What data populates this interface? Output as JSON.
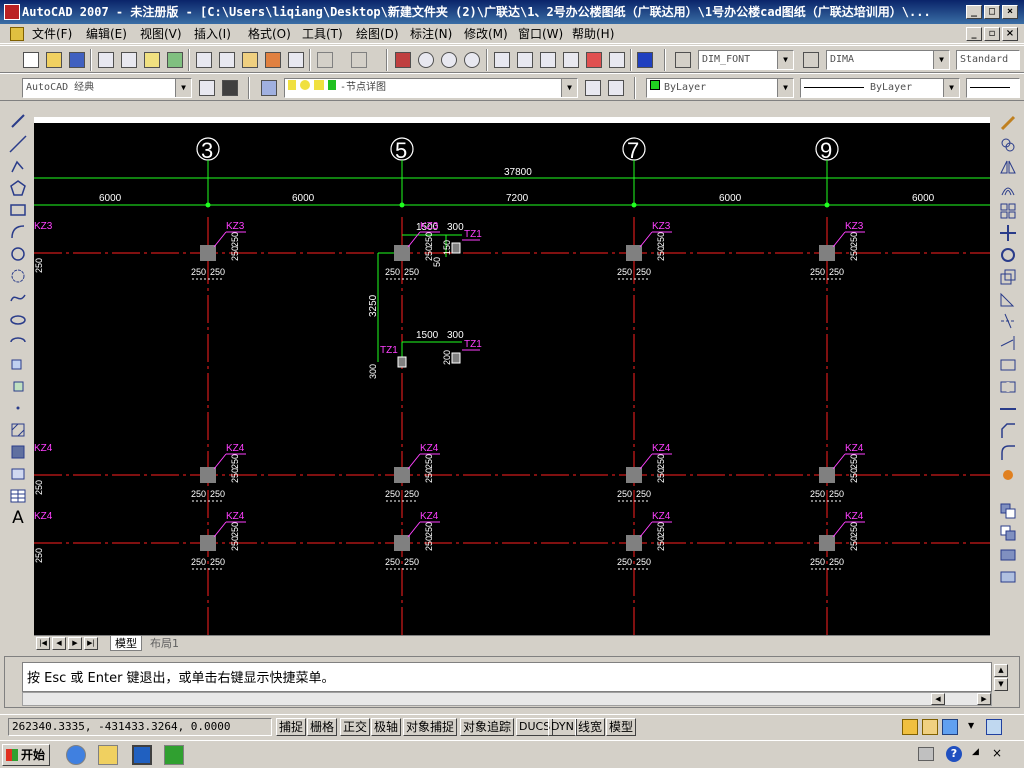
{
  "window": {
    "title": "AutoCAD 2007 - 未注册版 - [C:\\Users\\liqiang\\Desktop\\新建文件夹 (2)\\广联达\\1、2号办公楼图纸（广联达用）\\1号办公楼cad图纸（广联达培训用）\\..."
  },
  "menu": {
    "items": [
      "文件(F)",
      "编辑(E)",
      "视图(V)",
      "插入(I)",
      "格式(O)",
      "工具(T)",
      "绘图(D)",
      "标注(N)",
      "修改(M)",
      "窗口(W)",
      "帮助(H)"
    ]
  },
  "toolbar": {
    "dim_font": "DIM_FONT",
    "dim_style": "DIMA",
    "text_style": "Standard",
    "workspace": "AutoCAD 经典",
    "layer": "-节点详图",
    "color": "ByLayer",
    "linetype": "ByLayer"
  },
  "drawing": {
    "axes": [
      "3",
      "5",
      "7",
      "9"
    ],
    "overall_dim": "37800",
    "spans": [
      "6000",
      "6000",
      "7200",
      "6000",
      "6000"
    ],
    "dim_250": "250",
    "dim_1500": "1500",
    "dim_300": "300",
    "dim_150": "150",
    "dim_50": "50",
    "dim_3250": "3250",
    "dim_200": "200",
    "label_kz3": "KZ3",
    "label_kz4": "KZ4",
    "label_tz1": "TZ1"
  },
  "tabs": {
    "model": "模型",
    "layout1": "布局1"
  },
  "command": {
    "prompt": "按 Esc 或 Enter 键退出，或单击右键显示快捷菜单。"
  },
  "status": {
    "coords": "262340.3335, -431433.3264, 0.0000",
    "buttons": [
      "捕捉",
      "栅格",
      "正交",
      "极轴",
      "对象捕捉",
      "对象追踪",
      "DUCS",
      "DYN",
      "线宽",
      "模型"
    ]
  },
  "taskbar": {
    "start": "开始"
  },
  "colors": {
    "grid_red": "#ff2020",
    "dim_green": "#20ff20",
    "label_magenta": "#ff40ff",
    "column_gray": "#808080"
  }
}
